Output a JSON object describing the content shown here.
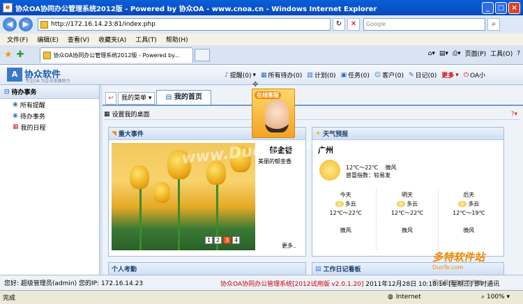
{
  "window": {
    "title": "协众OA协同办公管理系统2012版 - Powered by 协众OA - www.cnoa.cn - Windows Internet Explorer",
    "min": "_",
    "max": "□",
    "close": "×"
  },
  "browser": {
    "url": "http://172.16.14.23:81/index.php",
    "search_placeholder": "Google",
    "menus": [
      "文件(F)",
      "编辑(E)",
      "查看(V)",
      "收藏夹(A)",
      "工具(T)",
      "帮助(H)"
    ],
    "tab_title": "协众OA协同办公管理系统2012版 - Powered by...",
    "tools": [
      "页面(P)",
      "工具(O)"
    ]
  },
  "oa": {
    "logo_mark": "A",
    "logo_name": "协众软件",
    "slogan": "专注OA 为企业发展助力",
    "quick": [
      "提醒(0)",
      "所有待办(0)",
      "计划(0)",
      "任务(0)",
      "客户(0)",
      "日记(0)"
    ],
    "more": "更多",
    "oa_short": "OA小"
  },
  "sidebar": {
    "title": "待办事务",
    "items": [
      "所有提醒",
      "待办事务",
      "我的日程"
    ]
  },
  "main": {
    "my_menu": "我的菜单",
    "home_tab": "我的首页",
    "set_desk": "设置我的桌面"
  },
  "news": {
    "title": "重大事件",
    "headline": "郁金香",
    "desc": "美丽的郁金香",
    "pages": [
      "1",
      "2",
      "3",
      "4"
    ],
    "active_page": "3",
    "more": "更多.."
  },
  "weather": {
    "title": "天气预报",
    "city": "广州",
    "now_temp": "12℃～22℃",
    "now_wind": "微风",
    "comfort": "感冒指数：较易发",
    "days": [
      {
        "label": "今天",
        "cond": "多云",
        "temp": "12℃～22℃",
        "wind": "微风"
      },
      {
        "label": "明天",
        "cond": "多云",
        "temp": "12℃～22℃",
        "wind": "微风"
      },
      {
        "label": "后天",
        "cond": "多云",
        "temp": "12℃～19℃",
        "wind": "微风"
      }
    ]
  },
  "panels": {
    "attendance": "个人考勤",
    "diary": "工作日记看板"
  },
  "popup": {
    "label": "在线客服"
  },
  "status": {
    "user": "您好: 超级管理员(admin) 您的IP: 172.16.14.23",
    "product": "协众OA协同办公管理系统[2012试用版 v2.0.1.20]",
    "datetime": "2011年12月28日  10:18:16 [星期三]",
    "chat": "即时通讯"
  },
  "ie_status": {
    "left": "完成",
    "zone": "Internet",
    "zoom": "100%"
  },
  "watermarks": {
    "dt": "www.Duote.com",
    "brand": "多特软件站",
    "domain": "DuoTe.com",
    "tag": "国内最安全的软件站"
  }
}
